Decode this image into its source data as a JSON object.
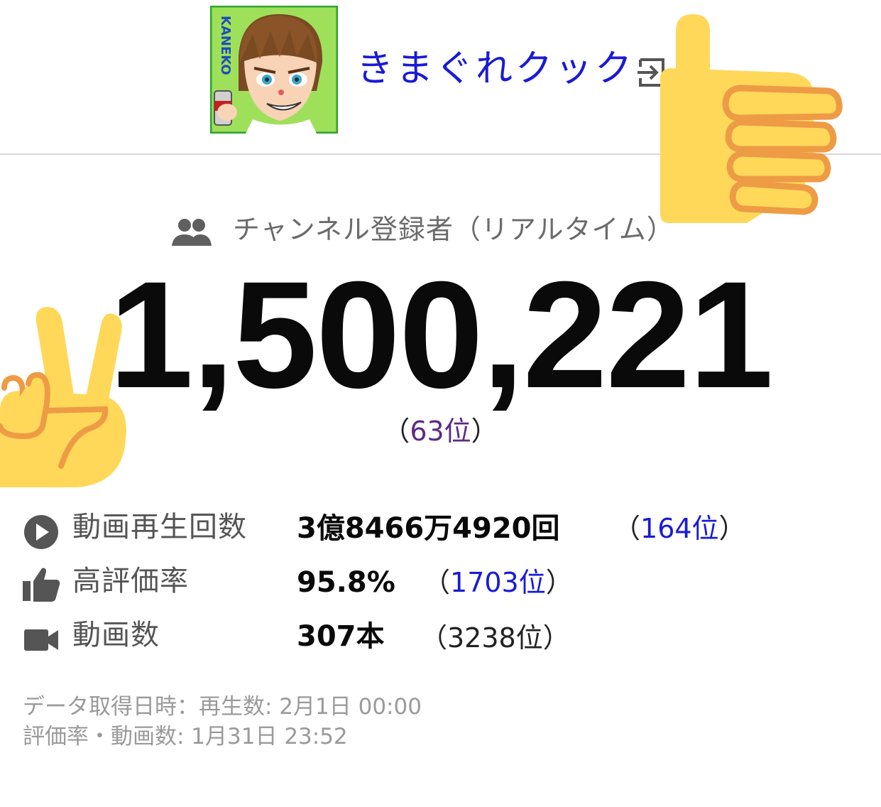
{
  "channel": {
    "name": "きまぐれクック",
    "avatar_text": "KANEKO"
  },
  "subscribers": {
    "label": "チャンネル登録者（リアルタイム）",
    "count": "1,500,221",
    "rank_open": "（",
    "rank": "63位",
    "rank_close": "）"
  },
  "stats": [
    {
      "icon": "play-circle-icon",
      "label": "動画再生回数",
      "value": "3億8466万4920回",
      "rank_open": "（",
      "rank": "164位",
      "rank_close": "）"
    },
    {
      "icon": "thumbs-up-icon",
      "label": "高評価率",
      "value": "95.8%",
      "rank_open": "（",
      "rank": "1703位",
      "rank_close": "）"
    },
    {
      "icon": "video-camera-icon",
      "label": "動画数",
      "value": "307本",
      "rank_text": "（3238位）"
    }
  ],
  "footer": {
    "line1": "データ取得日時：再生数: 2月1日 00:00",
    "line2": "評価率・動画数: 1月31日 23:52"
  },
  "colors": {
    "link_blue": "#1a1ad6",
    "rank_purple": "#5c2a86",
    "emoji_yellow": "#FFD85A",
    "emoji_outline": "#EE9B45"
  }
}
